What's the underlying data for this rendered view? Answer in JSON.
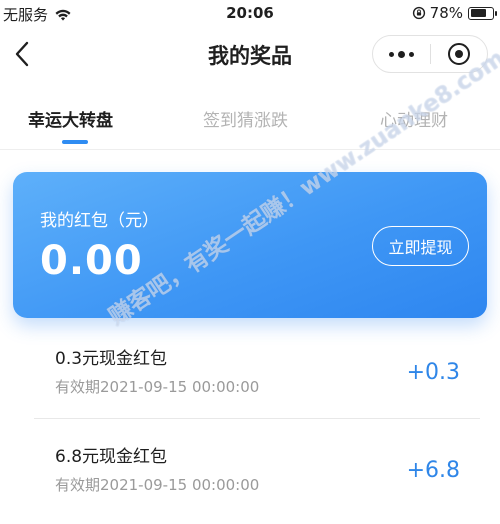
{
  "status_bar": {
    "carrier": "无服务",
    "time": "20:06",
    "battery": "78%",
    "battery_level": 0.78
  },
  "header": {
    "title": "我的奖品",
    "back_icon": "chevron-left-icon",
    "more_icon": "more-dots-icon",
    "close_icon": "target-close-icon"
  },
  "tabs": [
    {
      "label": "幸运大转盘",
      "active": true
    },
    {
      "label": "签到猜涨跌",
      "active": false
    },
    {
      "label": "心动理财",
      "active": false
    }
  ],
  "balance_card": {
    "label": "我的红包（元）",
    "amount": "0.00",
    "withdraw_label": "立即提现"
  },
  "rewards": [
    {
      "title": "0.3元现金红包",
      "expiry": "有效期2021-09-15 00:00:00",
      "amount": "+0.3"
    },
    {
      "title": "6.8元现金红包",
      "expiry": "有效期2021-09-15 00:00:00",
      "amount": "+6.8"
    }
  ],
  "watermark": "赚客吧，有奖一起赚！www.zuanke8.com",
  "colors": {
    "accent": "#2f86e8",
    "card_gradient_start": "#5eb0fa",
    "card_gradient_end": "#2e86f0"
  }
}
